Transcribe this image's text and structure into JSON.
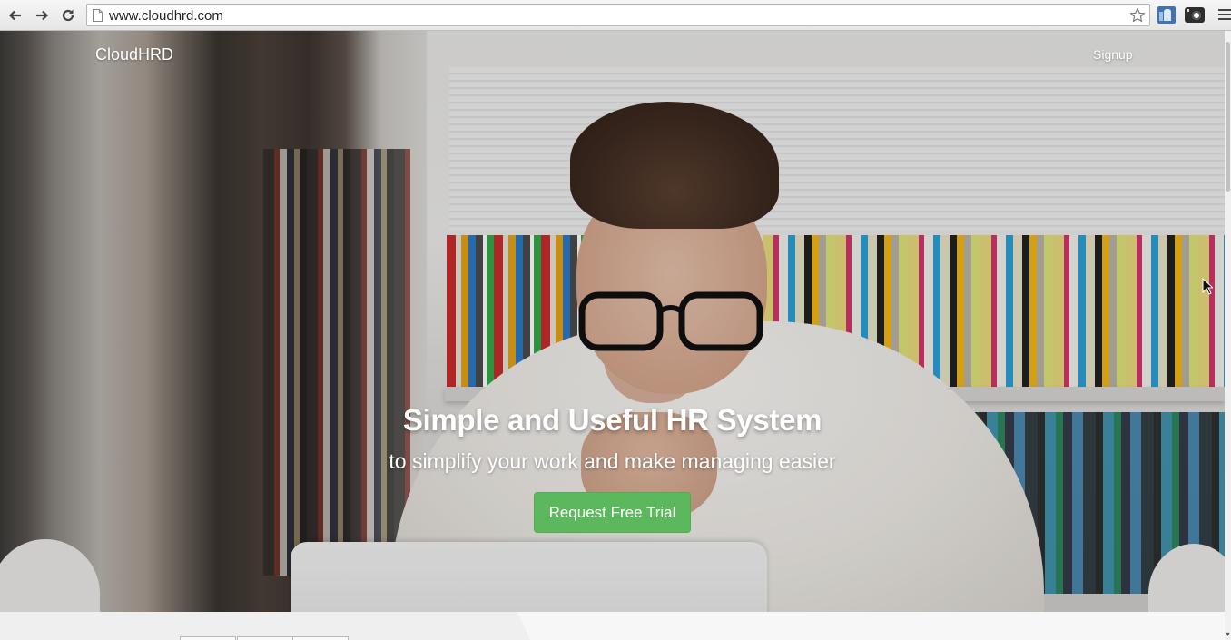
{
  "browser": {
    "url": "www.cloudhrd.com",
    "back_icon": "arrow-left-icon",
    "forward_icon": "arrow-right-icon",
    "reload_icon": "reload-icon",
    "page_icon": "document-icon",
    "bookmark_icon": "star-icon",
    "extensions": [
      "bookmark-extension-icon",
      "camera-extension-icon"
    ],
    "menu_icon": "hamburger-menu-icon"
  },
  "site": {
    "brand": "CloudHRD",
    "nav": {
      "signup": "Signup"
    },
    "hero": {
      "headline": "Simple and Useful HR System",
      "subheadline": "to simplify your work and make managing easier",
      "cta_label": "Request Free Trial"
    }
  },
  "colors": {
    "cta_green": "#5cb85c",
    "hero_text": "#ffffff",
    "chrome_bg": "#f0f0f0"
  }
}
